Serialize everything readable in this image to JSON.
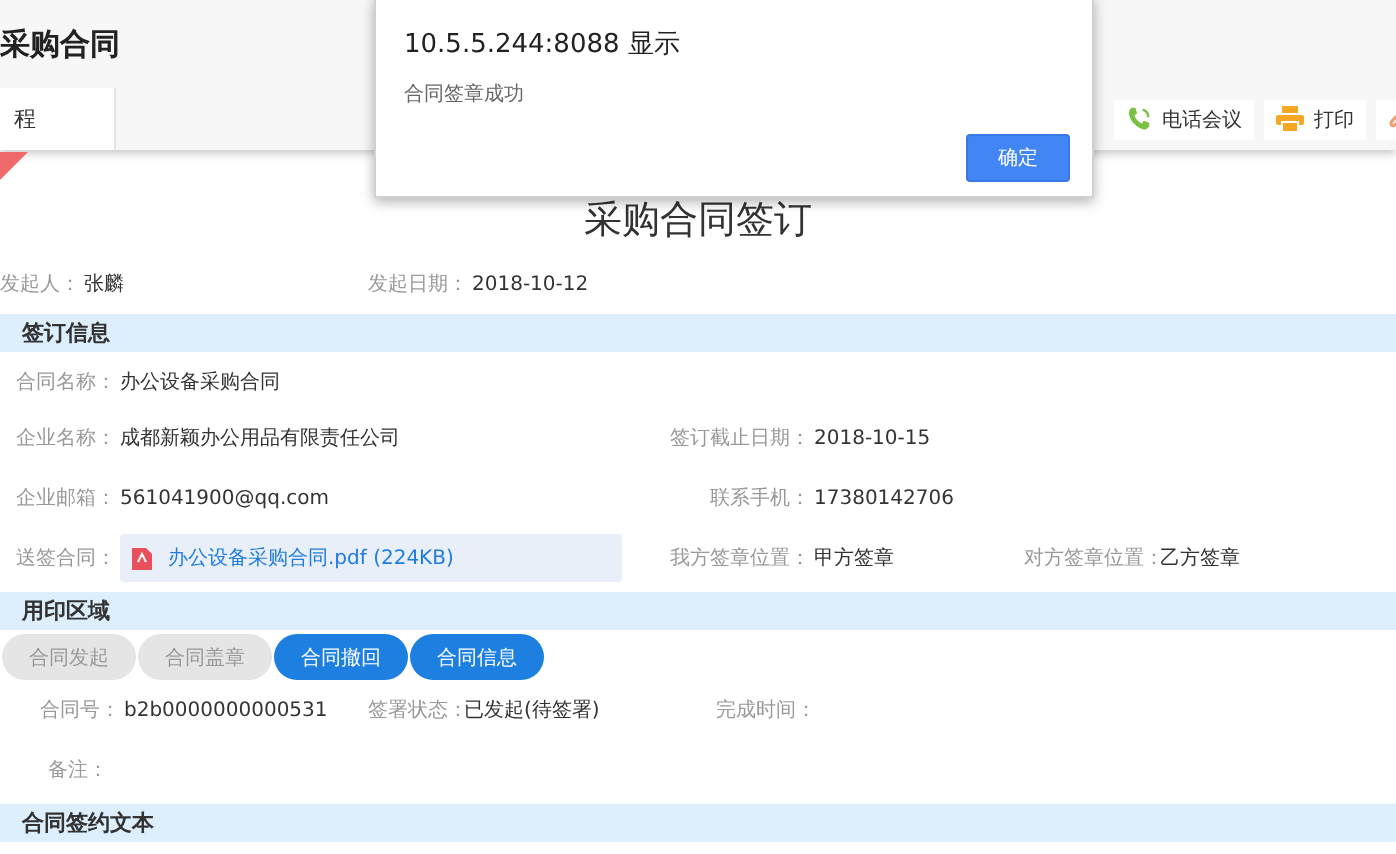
{
  "header": {
    "title": "采购合同",
    "tabs": [
      {
        "label": "程",
        "selected": false
      }
    ],
    "toolbar": [
      {
        "kind": "phone",
        "label": "电话会议"
      },
      {
        "kind": "printer",
        "label": "打印"
      },
      {
        "kind": "paperclip"
      }
    ]
  },
  "dialog": {
    "title": "10.5.5.244:8088 显示",
    "message": "合同签章成功",
    "button": "确定"
  },
  "page_title": "采购合同签订",
  "meta": [
    {
      "label": "发起人：",
      "value": "张麟"
    },
    {
      "label": "发起日期：",
      "value": "2018-10-12"
    }
  ],
  "sections": [
    {
      "title": "签订信息",
      "rows": [
        [
          {
            "label": "合同名称：",
            "value": "办公设备采购合同"
          }
        ],
        [
          {
            "label": "企业名称：",
            "value": "成都新颖办公用品有限责任公司"
          },
          {
            "label": "签订截止日期：",
            "value": "2018-10-15"
          }
        ],
        [
          {
            "label": "企业邮箱：",
            "value": "561041900@qq.com"
          },
          {
            "label": "联系手机：",
            "value": "17380142706"
          }
        ],
        [
          {
            "label": "送签合同：",
            "value": "办公设备采购合同.pdf (224KB)",
            "kind": "file"
          },
          {
            "label": "我方签章位置：",
            "value": "甲方签章"
          },
          {
            "label": "对方签章位置：",
            "value": "乙方签章"
          }
        ]
      ]
    },
    {
      "title": "用印区域",
      "actions": [
        {
          "label": "合同发起",
          "disabled": true
        },
        {
          "label": "合同盖章",
          "disabled": true
        },
        {
          "label": "合同撤回",
          "disabled": false
        },
        {
          "label": "合同信息",
          "disabled": false
        }
      ],
      "rows": [
        [
          {
            "label": "合同号：",
            "value": "b2b0000000000531"
          },
          {
            "label": "签署状态：",
            "value": "已发起(待签署)"
          },
          {
            "label": "完成时间："
          }
        ],
        [
          {
            "label": "备注："
          }
        ]
      ]
    },
    {
      "title": "合同签约文本"
    }
  ]
}
